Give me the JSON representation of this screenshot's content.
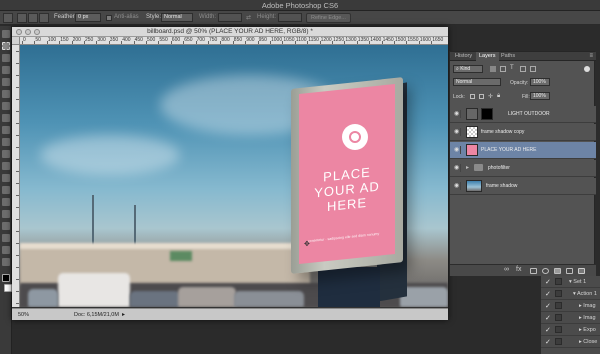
{
  "app": {
    "title": "Adobe Photoshop CS6"
  },
  "options_bar": {
    "feather_label": "Feather:",
    "feather_value": "0 px",
    "antialias_label": "Anti-alias",
    "style_label": "Style:",
    "style_value": "Normal",
    "width_label": "Width:",
    "height_label": "Height:",
    "refine_label": "Refine Edge..."
  },
  "document": {
    "title": "billboard.psd @ 50% (PLACE YOUR AD HERE, RGB/8) *",
    "ruler_top": [
      "0",
      "50",
      "100",
      "150",
      "200",
      "250",
      "300",
      "350",
      "400",
      "450",
      "500",
      "550",
      "600",
      "650",
      "700",
      "750",
      "800",
      "850",
      "900",
      "950",
      "1000",
      "1050",
      "1100",
      "1150",
      "1200",
      "1250",
      "1300",
      "1350",
      "1400",
      "1450",
      "1500",
      "1550",
      "1600",
      "1650",
      "1700"
    ],
    "zoom": "50%",
    "doc_size": "Doc: 6,15M/21,0M",
    "billboard_line1": "PLACE",
    "billboard_line2": "YOUR AD",
    "billboard_line3": "HERE",
    "billboard_small": "consetetur · sadipscing elitr sed diam nonumy"
  },
  "layers_panel": {
    "tabs": [
      "History",
      "Layers",
      "Paths"
    ],
    "active_tab": "Layers",
    "kind_label": "Kind",
    "blend_mode": "Normal",
    "opacity_label": "Opacity:",
    "opacity_value": "100%",
    "lock_label": "Lock:",
    "fill_label": "Fill:",
    "fill_value": "100%",
    "layers": [
      {
        "name": "LIGHT OUTDOOR",
        "selected": false
      },
      {
        "name": "frame shadow copy",
        "selected": false
      },
      {
        "name": "PLACE YOUR AD HERE",
        "selected": true
      },
      {
        "name": "photofilter",
        "selected": false
      },
      {
        "name": "frame shadow",
        "selected": false
      }
    ]
  },
  "actions_panel": {
    "items": [
      {
        "label": "Set 1"
      },
      {
        "label": "Action 1"
      },
      {
        "label": "Imag"
      },
      {
        "label": "Imag"
      },
      {
        "label": "Expo"
      },
      {
        "label": "Close"
      }
    ]
  },
  "colors": {
    "billboard_pink": "#ec86a3",
    "selection_blue": "#6d84a6",
    "ui_dark": "#535353"
  }
}
